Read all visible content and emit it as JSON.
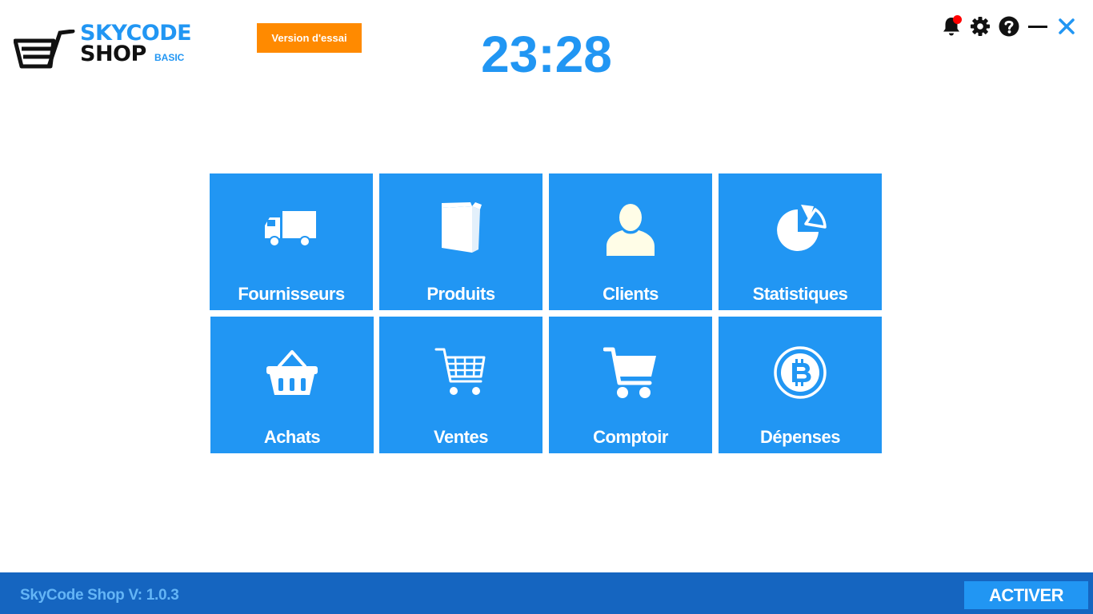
{
  "header": {
    "logo": {
      "line1": "SKYCODE",
      "line2": "SHOP",
      "edition": "BASIC"
    },
    "trial_badge": "Version d'essai",
    "clock": "23:28",
    "icons": [
      "bell-icon",
      "gear-icon",
      "help-icon",
      "minimize-icon",
      "close-icon"
    ]
  },
  "tiles": [
    {
      "label": "Fournisseurs",
      "icon": "truck-icon"
    },
    {
      "label": "Produits",
      "icon": "product-box-icon"
    },
    {
      "label": "Clients",
      "icon": "user-icon"
    },
    {
      "label": "Statistiques",
      "icon": "pie-chart-icon"
    },
    {
      "label": "Achats",
      "icon": "basket-icon"
    },
    {
      "label": "Ventes",
      "icon": "cart-grid-icon"
    },
    {
      "label": "Comptoir",
      "icon": "cart-icon"
    },
    {
      "label": "Dépenses",
      "icon": "bitcoin-icon"
    }
  ],
  "footer": {
    "version": "SkyCode Shop V: 1.0.3",
    "activate_label": "ACTIVER"
  },
  "colors": {
    "primary": "#2196f3",
    "footer": "#1565c0",
    "badge": "#ff8a00",
    "notification_dot": "#ff0000"
  }
}
